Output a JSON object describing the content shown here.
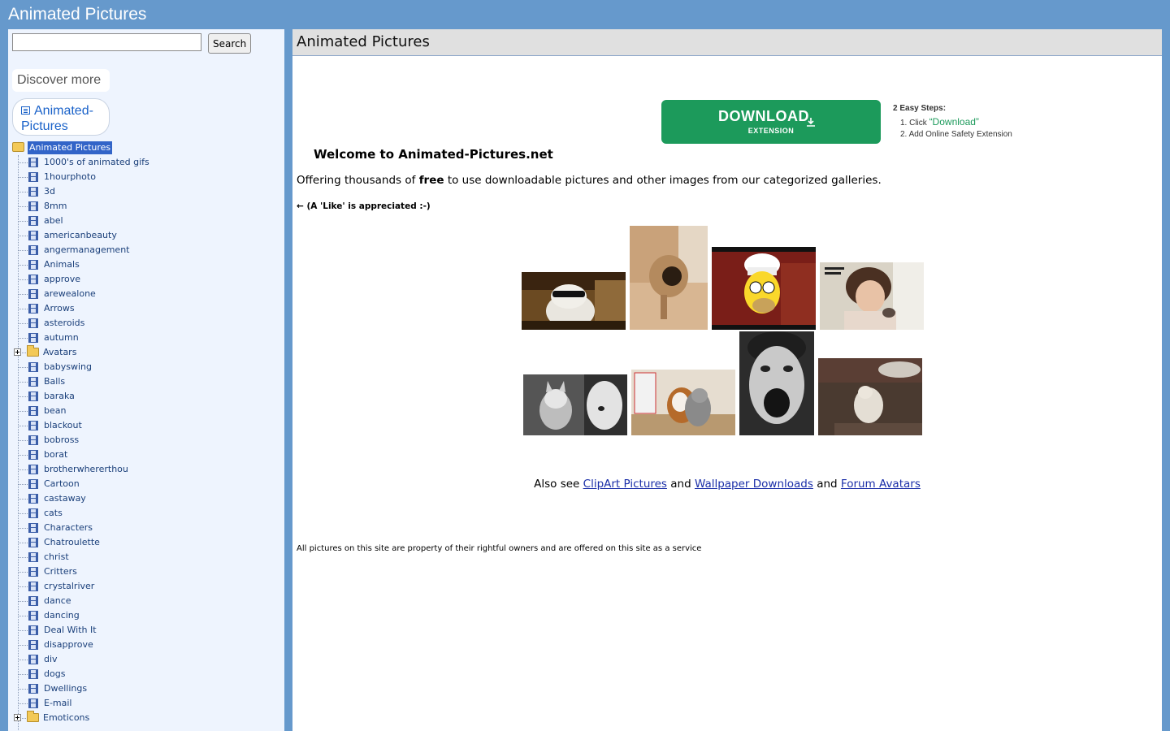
{
  "header": {
    "site_title": "Animated Pictures"
  },
  "sidebar": {
    "search": {
      "value": "",
      "placeholder": "",
      "button_label": "Search"
    },
    "discover_label": "Discover more",
    "pill_label": "Animated-Pictures",
    "tree": {
      "root_label": "Animated Pictures",
      "items": [
        {
          "label": "1000's of animated gifs",
          "type": "file"
        },
        {
          "label": "1hourphoto",
          "type": "file"
        },
        {
          "label": "3d",
          "type": "file"
        },
        {
          "label": "8mm",
          "type": "file"
        },
        {
          "label": "abel",
          "type": "file"
        },
        {
          "label": "americanbeauty",
          "type": "file"
        },
        {
          "label": "angermanagement",
          "type": "file"
        },
        {
          "label": "Animals",
          "type": "file"
        },
        {
          "label": "approve",
          "type": "file"
        },
        {
          "label": "arewealone",
          "type": "file"
        },
        {
          "label": "Arrows",
          "type": "file"
        },
        {
          "label": "asteroids",
          "type": "file"
        },
        {
          "label": "autumn",
          "type": "file"
        },
        {
          "label": "Avatars",
          "type": "folder"
        },
        {
          "label": "babyswing",
          "type": "file"
        },
        {
          "label": "Balls",
          "type": "file"
        },
        {
          "label": "baraka",
          "type": "file"
        },
        {
          "label": "bean",
          "type": "file"
        },
        {
          "label": "blackout",
          "type": "file"
        },
        {
          "label": "bobross",
          "type": "file"
        },
        {
          "label": "borat",
          "type": "file"
        },
        {
          "label": "brotherwhererthou",
          "type": "file"
        },
        {
          "label": "Cartoon",
          "type": "file"
        },
        {
          "label": "castaway",
          "type": "file"
        },
        {
          "label": "cats",
          "type": "file"
        },
        {
          "label": "Characters",
          "type": "file"
        },
        {
          "label": "Chatroulette",
          "type": "file"
        },
        {
          "label": "christ",
          "type": "file"
        },
        {
          "label": "Critters",
          "type": "file"
        },
        {
          "label": "crystalriver",
          "type": "file"
        },
        {
          "label": "dance",
          "type": "file"
        },
        {
          "label": "dancing",
          "type": "file"
        },
        {
          "label": "Deal With It",
          "type": "file"
        },
        {
          "label": "disapprove",
          "type": "file"
        },
        {
          "label": "div",
          "type": "file"
        },
        {
          "label": "dogs",
          "type": "file"
        },
        {
          "label": "Dwellings",
          "type": "file"
        },
        {
          "label": "E-mail",
          "type": "file"
        },
        {
          "label": "Emoticons",
          "type": "folder"
        }
      ]
    }
  },
  "main": {
    "title": "Animated Pictures",
    "ad": {
      "button_label": "DOWNLOAD",
      "button_sub": "EXTENSION",
      "steps_title": "2 Easy Steps:",
      "step1_prefix": "1. Click ",
      "step1_highlight": "“Download”",
      "step2": "2. Add Online Safety Extension"
    },
    "welcome": "Welcome to Animated-Pictures.net",
    "offer_before": "Offering thousands of ",
    "offer_bold": "free",
    "offer_after": " to use downloadable pictures and other images from our categorized galleries.",
    "like_text": "← (A 'Like' is appreciated :-)",
    "thumbnails": [
      {
        "name": "cat-sunglasses-thumbnail"
      },
      {
        "name": "pug-thumbnail"
      },
      {
        "name": "homer-chef-thumbnail"
      },
      {
        "name": "girl-phone-thumbnail"
      },
      {
        "name": "cat-and-woman-thumbnail"
      },
      {
        "name": "dog-and-cat-thumbnail"
      },
      {
        "name": "man-screaming-thumbnail"
      },
      {
        "name": "cat-on-floor-thumbnail"
      }
    ],
    "also": {
      "prefix": "Also see ",
      "link1": "ClipArt Pictures",
      "and1": " and ",
      "link2": "Wallpaper Downloads",
      "and2": " and ",
      "link3": "Forum Avatars"
    },
    "footer": "All pictures on this site are property of their rightful owners and are offered on this site as a service"
  }
}
